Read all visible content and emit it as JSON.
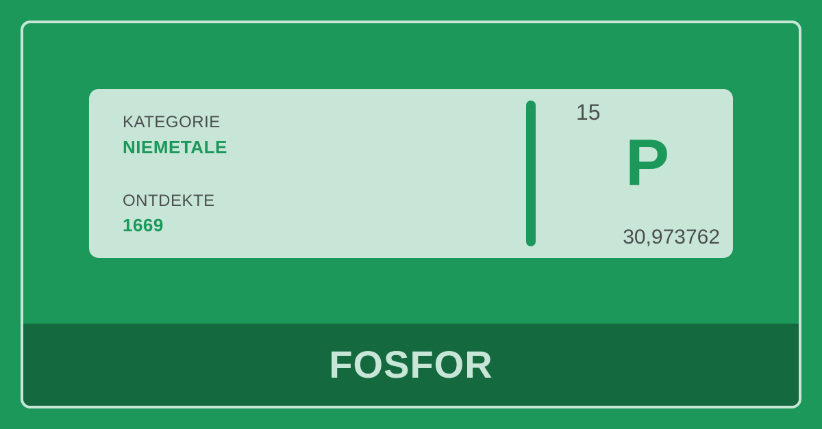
{
  "card": {
    "category_label": "KATEGORIE",
    "category_value": "NIEMETALE",
    "discovered_label": "ONTDEKTE",
    "discovered_value": "1669",
    "atomic_number": "15",
    "symbol": "P",
    "atomic_mass": "30,973762"
  },
  "footer": {
    "element_name": "FOSFOR"
  },
  "colors": {
    "background": "#1b985a",
    "card": "#c8e6d8",
    "footer": "#146a3e",
    "text_dark": "#4b4f4d"
  }
}
